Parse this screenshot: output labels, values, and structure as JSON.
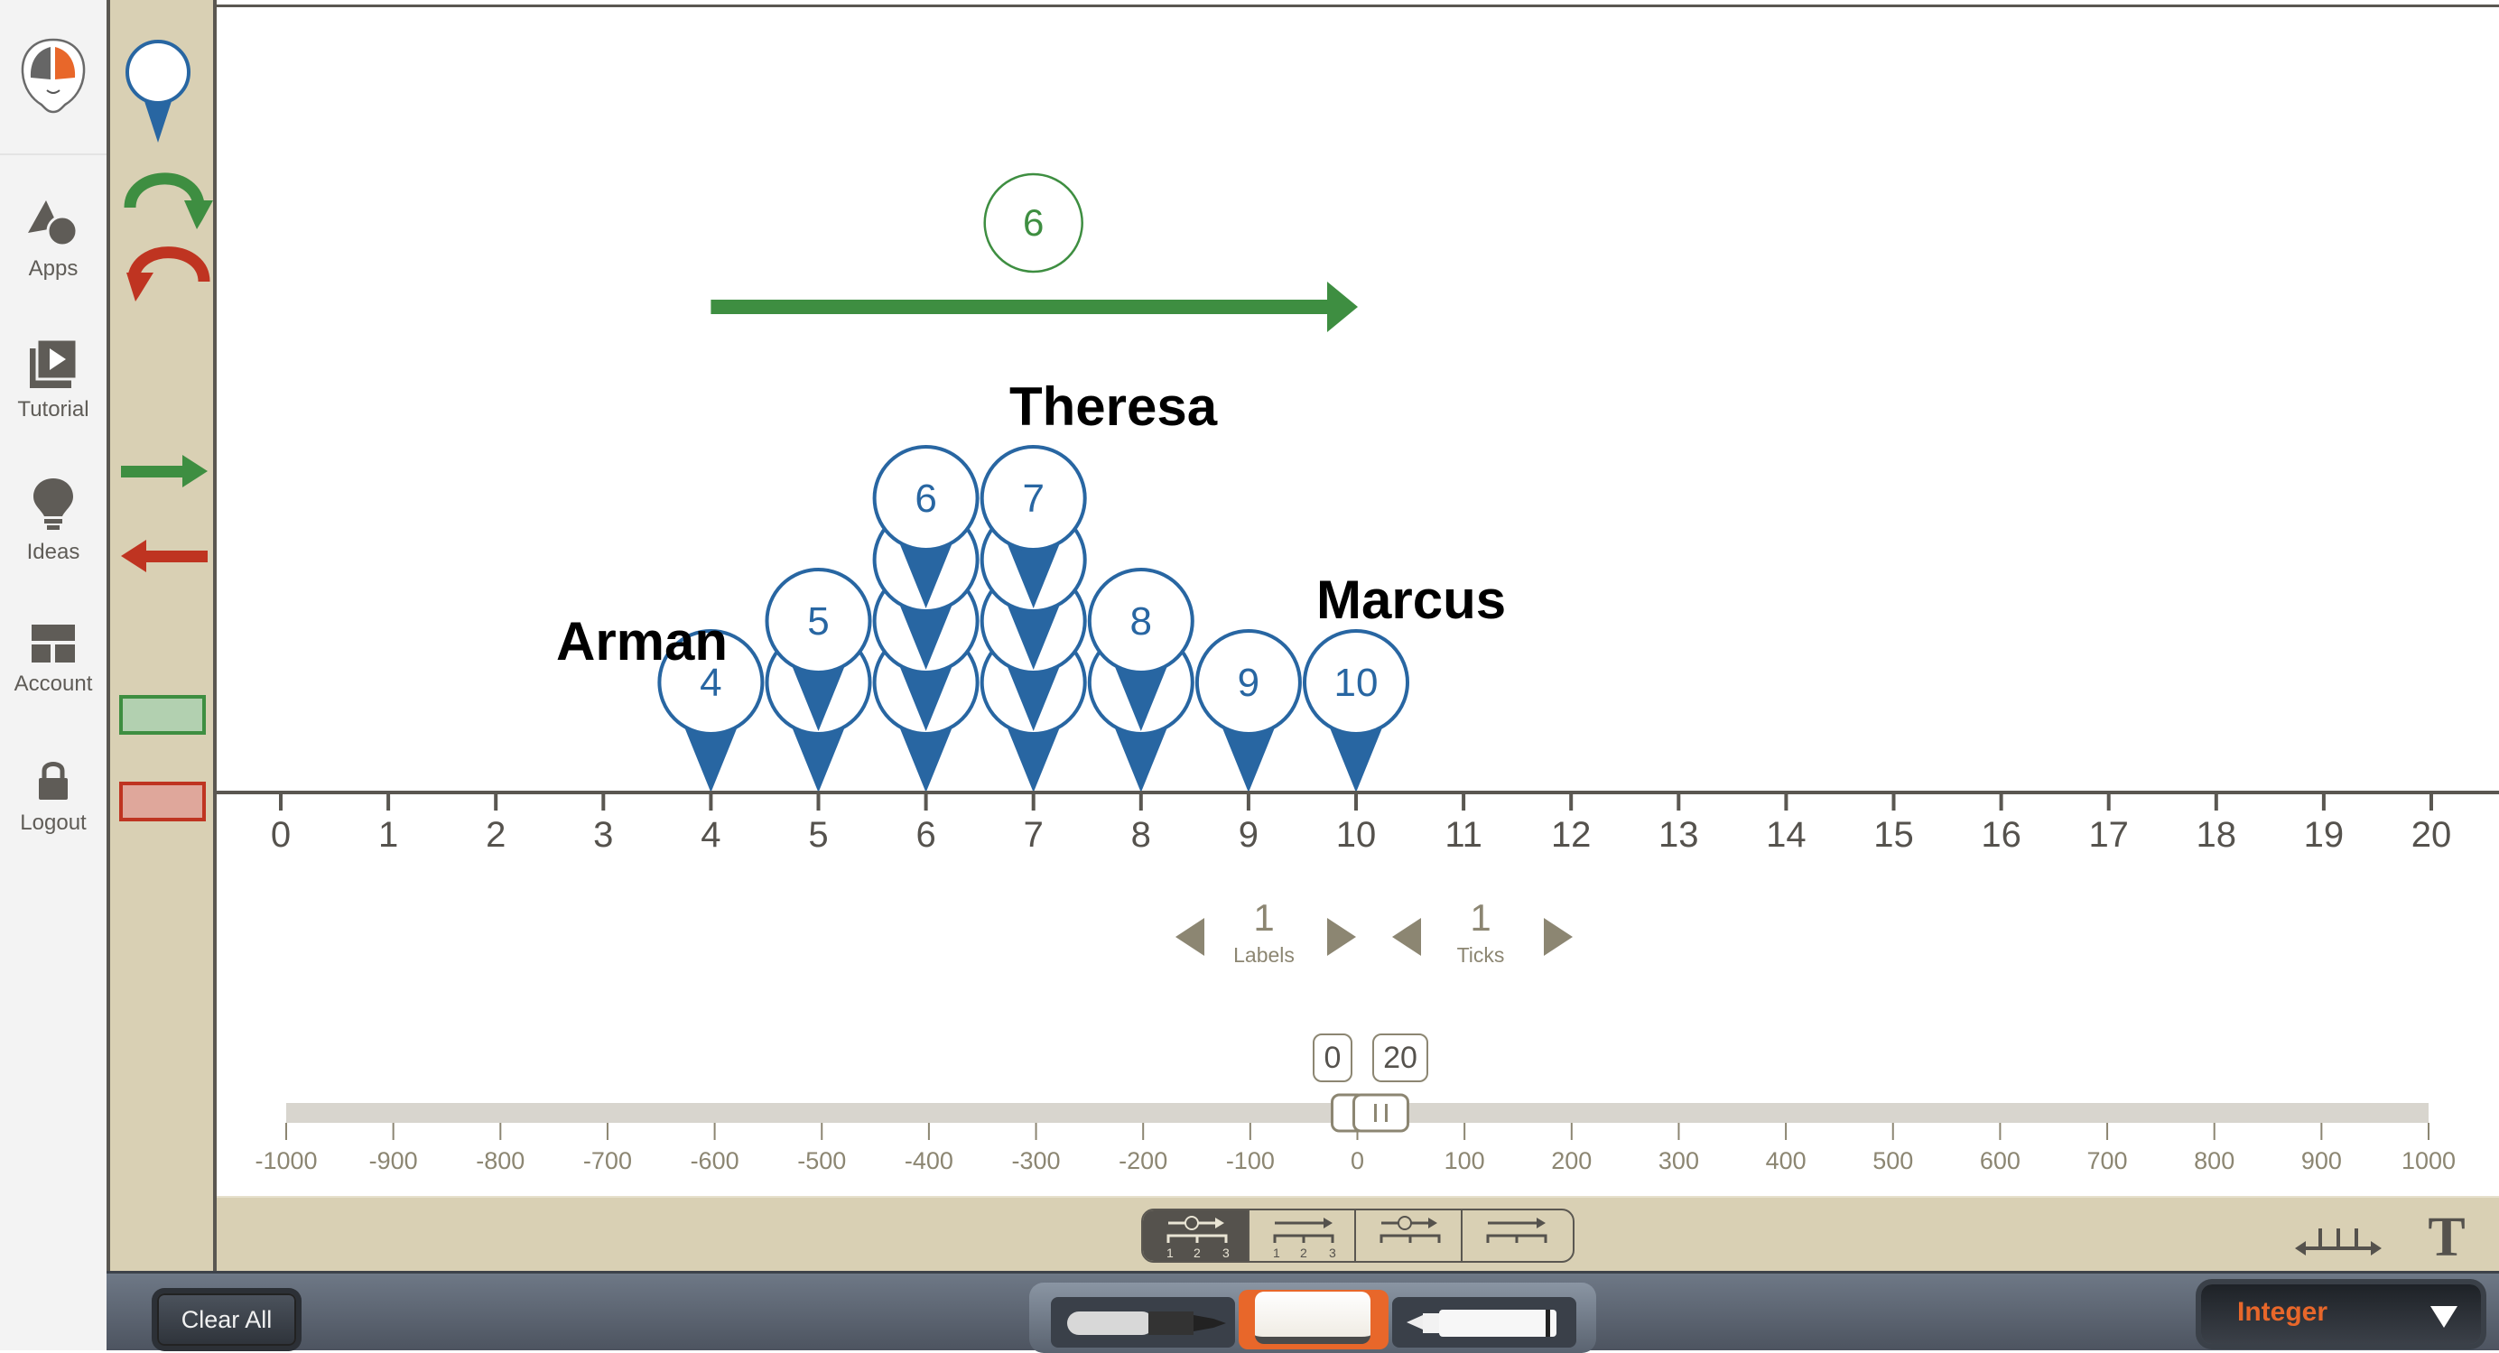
{
  "sidebar": {
    "logo": "brain-head-logo",
    "items": [
      {
        "label": "Apps",
        "icon": "shapes-icon"
      },
      {
        "label": "Tutorial",
        "icon": "video-library-icon"
      },
      {
        "label": "Ideas",
        "icon": "lightbulb-icon"
      },
      {
        "label": "Account",
        "icon": "dashboard-layout-icon"
      },
      {
        "label": "Logout",
        "icon": "lock-icon"
      }
    ]
  },
  "tools": [
    {
      "name": "pin-tool",
      "icon": "map-pin-icon"
    },
    {
      "name": "jump-right-tool",
      "icon": "curved-arrow-right-icon"
    },
    {
      "name": "jump-left-tool",
      "icon": "curved-arrow-left-icon"
    },
    {
      "name": "arrow-right-tool",
      "icon": "arrow-right-icon"
    },
    {
      "name": "arrow-left-tool",
      "icon": "arrow-left-icon"
    },
    {
      "name": "green-bar-tool",
      "icon": "green-rectangle-icon"
    },
    {
      "name": "red-bar-tool",
      "icon": "red-rectangle-icon"
    }
  ],
  "colors": {
    "pin_blue": "#2866a2",
    "arrow_green": "#3e8e41",
    "arrow_red": "#bf3421",
    "tool_bg": "#d9d0b4",
    "axis": "#5a5751",
    "accent_orange": "#e8672a"
  },
  "number_line": {
    "min": 0,
    "max": 20,
    "tick_labels": [
      "0",
      "1",
      "2",
      "3",
      "4",
      "5",
      "6",
      "7",
      "8",
      "9",
      "10",
      "11",
      "12",
      "13",
      "14",
      "15",
      "16",
      "17",
      "18",
      "19",
      "20"
    ]
  },
  "jump_arrow": {
    "from": 4,
    "to": 10,
    "label": "6"
  },
  "pin_stacks": [
    {
      "value": 4,
      "count": 1,
      "top_label": "4"
    },
    {
      "value": 5,
      "count": 2,
      "top_label": "5"
    },
    {
      "value": 6,
      "count": 4,
      "top_label": "6"
    },
    {
      "value": 7,
      "count": 4,
      "top_label": "7"
    },
    {
      "value": 8,
      "count": 2,
      "top_label": "8"
    },
    {
      "value": 9,
      "count": 1,
      "top_label": "9"
    },
    {
      "value": 10,
      "count": 1,
      "top_label": "10"
    }
  ],
  "text_labels": [
    {
      "text": "Arman",
      "near_value": 4
    },
    {
      "text": "Theresa",
      "near_value": 7
    },
    {
      "text": "Marcus",
      "near_value": 10
    }
  ],
  "steppers": {
    "labels": {
      "value": "1",
      "caption": "Labels"
    },
    "ticks": {
      "value": "1",
      "caption": "Ticks"
    }
  },
  "range": {
    "min_value": "0",
    "max_value": "20"
  },
  "range_slider": {
    "min": -1000,
    "max": 1000,
    "window_start": 0,
    "window_end": 20,
    "tick_labels": [
      "-1000",
      "-900",
      "-800",
      "-700",
      "-600",
      "-500",
      "-400",
      "-300",
      "-200",
      "-100",
      "0",
      "100",
      "200",
      "300",
      "400",
      "500",
      "600",
      "700",
      "800",
      "900",
      "1000"
    ]
  },
  "mode_buttons": [
    {
      "name": "jump-with-labels",
      "selected": true
    },
    {
      "name": "arrow-with-labels",
      "selected": false
    },
    {
      "name": "jump-no-labels",
      "selected": false
    },
    {
      "name": "arrow-no-labels",
      "selected": false
    }
  ],
  "bottom_bar": {
    "clear_all": "Clear All",
    "number_type": "Integer",
    "drawing_tools": [
      "marker-black",
      "eraser",
      "marker-white"
    ],
    "selected_tool": "eraser"
  }
}
